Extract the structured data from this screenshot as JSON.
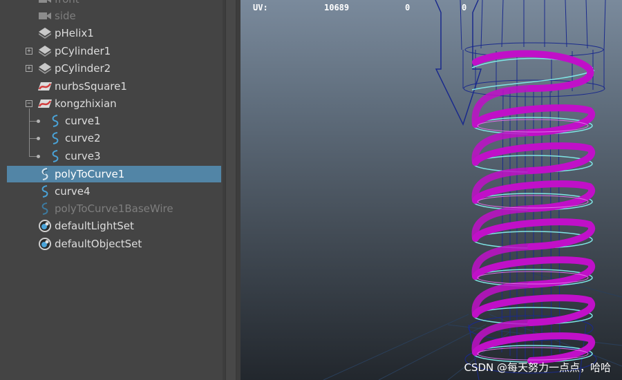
{
  "outliner": {
    "items": [
      {
        "label": "front",
        "icon": "camera-icon",
        "dim": true
      },
      {
        "label": "side",
        "icon": "camera-icon",
        "dim": true
      },
      {
        "label": "pHelix1",
        "icon": "transform-icon"
      },
      {
        "label": "pCylinder1",
        "icon": "transform-icon",
        "expander": "+"
      },
      {
        "label": "pCylinder2",
        "icon": "transform-icon",
        "expander": "+"
      },
      {
        "label": "nurbsSquare1",
        "icon": "nurbs-curve-icon"
      },
      {
        "label": "kongzhixian",
        "icon": "nurbs-curve-icon",
        "expander": "−"
      },
      {
        "label": "curve1",
        "icon": "curve-icon",
        "child": true
      },
      {
        "label": "curve2",
        "icon": "curve-icon",
        "child": true
      },
      {
        "label": "curve3",
        "icon": "curve-icon",
        "child": true
      },
      {
        "label": "polyToCurve1",
        "icon": "curve-icon",
        "selected": true
      },
      {
        "label": "curve4",
        "icon": "curve-icon"
      },
      {
        "label": "polyToCurve1BaseWire",
        "icon": "curve-icon",
        "dim": true
      },
      {
        "label": "defaultLightSet",
        "icon": "set-icon"
      },
      {
        "label": "defaultObjectSet",
        "icon": "set-icon"
      }
    ]
  },
  "viewport": {
    "hud": {
      "label": "UV:",
      "value1": "10689",
      "value2": "0",
      "value3": "0"
    }
  },
  "watermark": "CSDN @每天努力一点点，哈哈",
  "colors": {
    "selection": "#5285a6",
    "helix": "#c010c8",
    "wireframe": "#1a2a8c",
    "curve_highlight": "#7fe6e6"
  }
}
